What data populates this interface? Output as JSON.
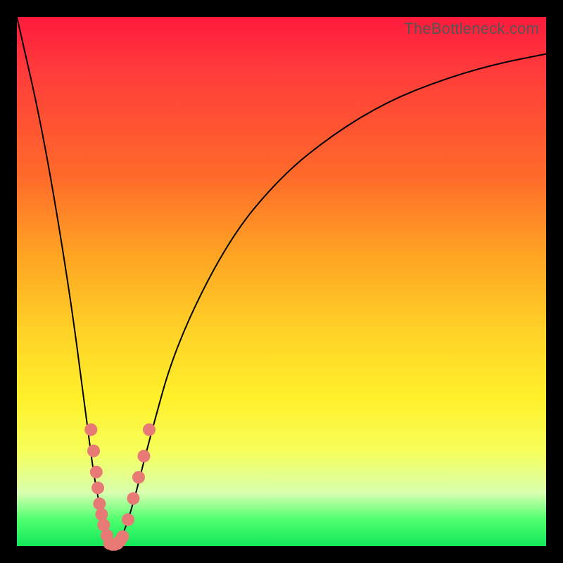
{
  "watermark": "TheBottleneck.com",
  "chart_data": {
    "type": "line",
    "title": "",
    "xlabel": "",
    "ylabel": "",
    "xlim": [
      0,
      100
    ],
    "ylim": [
      0,
      100
    ],
    "grid": false,
    "legend": false,
    "series": [
      {
        "name": "bottleneck-curve",
        "x": [
          0,
          5,
          10,
          13,
          15,
          17,
          18,
          19,
          20,
          22,
          25,
          30,
          40,
          50,
          60,
          70,
          80,
          90,
          100
        ],
        "values": [
          100,
          78,
          48,
          25,
          10,
          3,
          0,
          0,
          2,
          8,
          20,
          38,
          58,
          70,
          78,
          84,
          88,
          91,
          93
        ]
      },
      {
        "name": "marker-cluster-left",
        "x": [
          14,
          14.5,
          15,
          15.3,
          15.6,
          16,
          16.4,
          17
        ],
        "values": [
          22,
          18,
          14,
          11,
          8,
          6,
          4,
          2
        ]
      },
      {
        "name": "marker-cluster-bottom",
        "x": [
          17.5,
          18,
          18.5,
          19,
          19.5,
          20
        ],
        "values": [
          0.5,
          0.3,
          0.3,
          0.5,
          1,
          1.8
        ]
      },
      {
        "name": "marker-cluster-right",
        "x": [
          21,
          22,
          23,
          24,
          25
        ],
        "values": [
          5,
          9,
          13,
          17,
          22
        ]
      }
    ],
    "colors": {
      "curve": "#000000",
      "markers": "#e77a74"
    }
  }
}
